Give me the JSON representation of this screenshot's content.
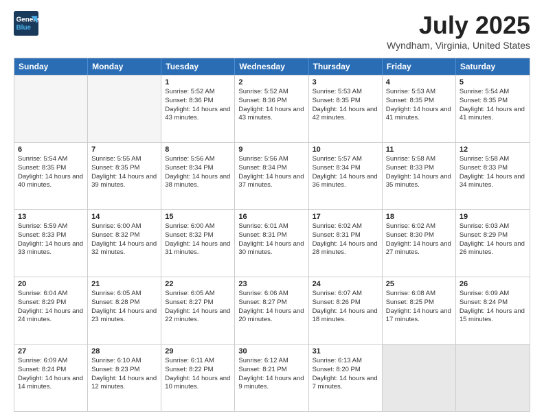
{
  "header": {
    "logo_line1": "General",
    "logo_line2": "Blue",
    "title": "July 2025",
    "subtitle": "Wyndham, Virginia, United States"
  },
  "weekdays": [
    "Sunday",
    "Monday",
    "Tuesday",
    "Wednesday",
    "Thursday",
    "Friday",
    "Saturday"
  ],
  "weeks": [
    [
      {
        "day": "",
        "info": "",
        "empty": true
      },
      {
        "day": "",
        "info": "",
        "empty": true
      },
      {
        "day": "1",
        "info": "Sunrise: 5:52 AM\nSunset: 8:36 PM\nDaylight: 14 hours and 43 minutes."
      },
      {
        "day": "2",
        "info": "Sunrise: 5:52 AM\nSunset: 8:36 PM\nDaylight: 14 hours and 43 minutes."
      },
      {
        "day": "3",
        "info": "Sunrise: 5:53 AM\nSunset: 8:35 PM\nDaylight: 14 hours and 42 minutes."
      },
      {
        "day": "4",
        "info": "Sunrise: 5:53 AM\nSunset: 8:35 PM\nDaylight: 14 hours and 41 minutes."
      },
      {
        "day": "5",
        "info": "Sunrise: 5:54 AM\nSunset: 8:35 PM\nDaylight: 14 hours and 41 minutes."
      }
    ],
    [
      {
        "day": "6",
        "info": "Sunrise: 5:54 AM\nSunset: 8:35 PM\nDaylight: 14 hours and 40 minutes."
      },
      {
        "day": "7",
        "info": "Sunrise: 5:55 AM\nSunset: 8:35 PM\nDaylight: 14 hours and 39 minutes."
      },
      {
        "day": "8",
        "info": "Sunrise: 5:56 AM\nSunset: 8:34 PM\nDaylight: 14 hours and 38 minutes."
      },
      {
        "day": "9",
        "info": "Sunrise: 5:56 AM\nSunset: 8:34 PM\nDaylight: 14 hours and 37 minutes."
      },
      {
        "day": "10",
        "info": "Sunrise: 5:57 AM\nSunset: 8:34 PM\nDaylight: 14 hours and 36 minutes."
      },
      {
        "day": "11",
        "info": "Sunrise: 5:58 AM\nSunset: 8:33 PM\nDaylight: 14 hours and 35 minutes."
      },
      {
        "day": "12",
        "info": "Sunrise: 5:58 AM\nSunset: 8:33 PM\nDaylight: 14 hours and 34 minutes."
      }
    ],
    [
      {
        "day": "13",
        "info": "Sunrise: 5:59 AM\nSunset: 8:33 PM\nDaylight: 14 hours and 33 minutes."
      },
      {
        "day": "14",
        "info": "Sunrise: 6:00 AM\nSunset: 8:32 PM\nDaylight: 14 hours and 32 minutes."
      },
      {
        "day": "15",
        "info": "Sunrise: 6:00 AM\nSunset: 8:32 PM\nDaylight: 14 hours and 31 minutes."
      },
      {
        "day": "16",
        "info": "Sunrise: 6:01 AM\nSunset: 8:31 PM\nDaylight: 14 hours and 30 minutes."
      },
      {
        "day": "17",
        "info": "Sunrise: 6:02 AM\nSunset: 8:31 PM\nDaylight: 14 hours and 28 minutes."
      },
      {
        "day": "18",
        "info": "Sunrise: 6:02 AM\nSunset: 8:30 PM\nDaylight: 14 hours and 27 minutes."
      },
      {
        "day": "19",
        "info": "Sunrise: 6:03 AM\nSunset: 8:29 PM\nDaylight: 14 hours and 26 minutes."
      }
    ],
    [
      {
        "day": "20",
        "info": "Sunrise: 6:04 AM\nSunset: 8:29 PM\nDaylight: 14 hours and 24 minutes."
      },
      {
        "day": "21",
        "info": "Sunrise: 6:05 AM\nSunset: 8:28 PM\nDaylight: 14 hours and 23 minutes."
      },
      {
        "day": "22",
        "info": "Sunrise: 6:05 AM\nSunset: 8:27 PM\nDaylight: 14 hours and 22 minutes."
      },
      {
        "day": "23",
        "info": "Sunrise: 6:06 AM\nSunset: 8:27 PM\nDaylight: 14 hours and 20 minutes."
      },
      {
        "day": "24",
        "info": "Sunrise: 6:07 AM\nSunset: 8:26 PM\nDaylight: 14 hours and 18 minutes."
      },
      {
        "day": "25",
        "info": "Sunrise: 6:08 AM\nSunset: 8:25 PM\nDaylight: 14 hours and 17 minutes."
      },
      {
        "day": "26",
        "info": "Sunrise: 6:09 AM\nSunset: 8:24 PM\nDaylight: 14 hours and 15 minutes."
      }
    ],
    [
      {
        "day": "27",
        "info": "Sunrise: 6:09 AM\nSunset: 8:24 PM\nDaylight: 14 hours and 14 minutes."
      },
      {
        "day": "28",
        "info": "Sunrise: 6:10 AM\nSunset: 8:23 PM\nDaylight: 14 hours and 12 minutes."
      },
      {
        "day": "29",
        "info": "Sunrise: 6:11 AM\nSunset: 8:22 PM\nDaylight: 14 hours and 10 minutes."
      },
      {
        "day": "30",
        "info": "Sunrise: 6:12 AM\nSunset: 8:21 PM\nDaylight: 14 hours and 9 minutes."
      },
      {
        "day": "31",
        "info": "Sunrise: 6:13 AM\nSunset: 8:20 PM\nDaylight: 14 hours and 7 minutes."
      },
      {
        "day": "",
        "info": "",
        "empty": true,
        "shaded": true
      },
      {
        "day": "",
        "info": "",
        "empty": true,
        "shaded": true
      }
    ]
  ]
}
